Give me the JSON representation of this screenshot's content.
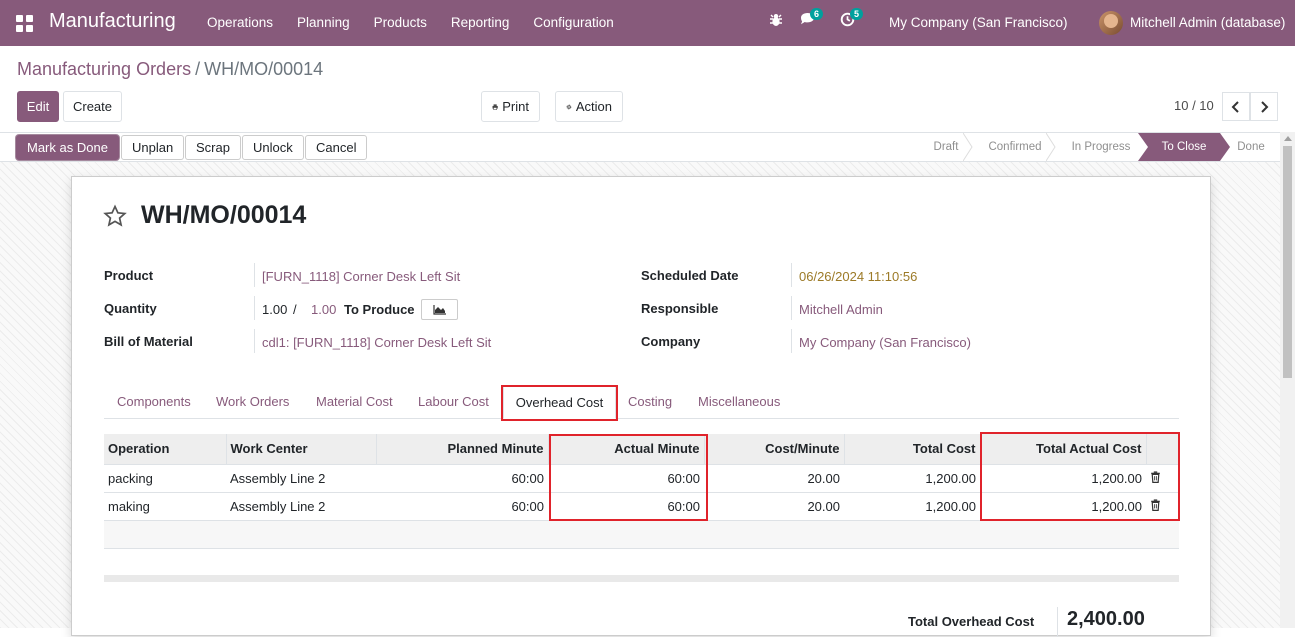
{
  "navbar": {
    "brand": "Manufacturing",
    "menu": [
      "Operations",
      "Planning",
      "Products",
      "Reporting",
      "Configuration"
    ],
    "chat_badge": "6",
    "activity_badge": "5",
    "company": "My Company (San Francisco)",
    "user": "Mitchell Admin (database)"
  },
  "breadcrumb": {
    "parent": "Manufacturing Orders",
    "sep": "/",
    "current": "WH/MO/00014"
  },
  "controls": {
    "edit": "Edit",
    "create": "Create",
    "print": "Print",
    "action": "Action",
    "pager": "10 / 10"
  },
  "statusbar": {
    "buttons": [
      "Mark as Done",
      "Unplan",
      "Scrap",
      "Unlock",
      "Cancel"
    ],
    "stages": [
      "Draft",
      "Confirmed",
      "In Progress",
      "To Close",
      "Done"
    ],
    "active_stage": "To Close"
  },
  "form": {
    "title": "WH/MO/00014",
    "product_label": "Product",
    "product": "[FURN_1118] Corner Desk Left Sit",
    "quantity_label": "Quantity",
    "qty_produced": "1.00",
    "qty_sep": "/",
    "qty_total": "1.00",
    "to_produce": "To Produce",
    "bom_label": "Bill of Material",
    "bom": "cdl1: [FURN_1118] Corner Desk Left Sit",
    "scheduled_label": "Scheduled Date",
    "scheduled": "06/26/2024 11:10:56",
    "responsible_label": "Responsible",
    "responsible": "Mitchell Admin",
    "company_label": "Company",
    "company": "My Company (San Francisco)"
  },
  "tabs": [
    "Components",
    "Work Orders",
    "Material Cost",
    "Labour Cost",
    "Overhead Cost",
    "Costing",
    "Miscellaneous"
  ],
  "active_tab": "Overhead Cost",
  "table": {
    "headers": [
      "Operation",
      "Work Center",
      "Planned Minute",
      "Actual Minute",
      "Cost/Minute",
      "Total Cost",
      "Total Actual Cost"
    ],
    "rows": [
      [
        "packing",
        "Assembly Line 2",
        "60:00",
        "60:00",
        "20.00",
        "1,200.00",
        "1,200.00"
      ],
      [
        "making",
        "Assembly Line 2",
        "60:00",
        "60:00",
        "20.00",
        "1,200.00",
        "1,200.00"
      ]
    ]
  },
  "totals": {
    "label": "Total Overhead Cost",
    "value": "2,400.00"
  },
  "colors": {
    "brand": "#875a7b",
    "highlight": "#e0232b",
    "date": "#9c7a27"
  }
}
